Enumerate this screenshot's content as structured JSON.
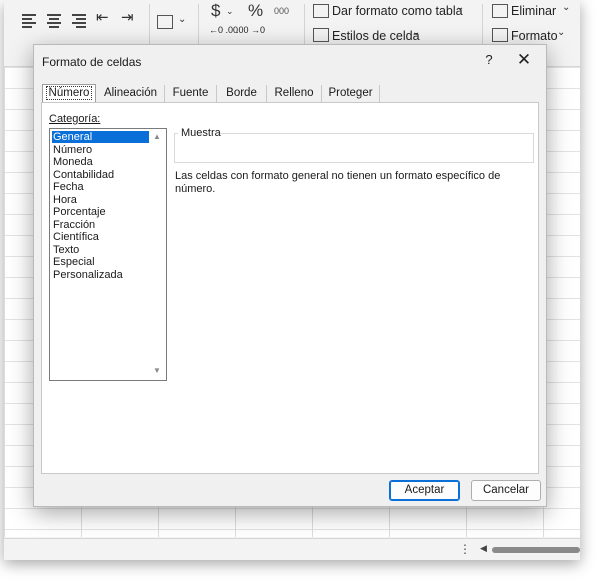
{
  "ribbon": {
    "currency_symbol": "$",
    "percent_symbol": "%",
    "thousands_label": "000",
    "decimal_increase_label": "←0 .00",
    "decimal_decrease_label": ".00 →0",
    "format_as_table_label": "Dar formato como tabla",
    "cell_styles_label": "Estilos de celda",
    "delete_label": "Eliminar",
    "format_label": "Formato"
  },
  "dialog": {
    "title": "Formato de celdas",
    "help_label": "?",
    "close_label": "✕",
    "tabs": [
      {
        "label": "Número"
      },
      {
        "label": "Alineación"
      },
      {
        "label": "Fuente"
      },
      {
        "label": "Borde"
      },
      {
        "label": "Relleno"
      },
      {
        "label": "Proteger"
      }
    ],
    "category_label": "Categoría:",
    "categories": [
      "General",
      "Número",
      "Moneda",
      "Contabilidad",
      "Fecha",
      "Hora",
      "Porcentaje",
      "Fracción",
      "Científica",
      "Texto",
      "Especial",
      "Personalizada"
    ],
    "selected_category": "General",
    "sample_label": "Muestra",
    "description": "Las celdas con formato general no tienen un formato específico de número.",
    "ok_label": "Aceptar",
    "cancel_label": "Cancelar"
  },
  "colors": {
    "accent": "#0b6fd8",
    "dialog_bg": "#f0f0f0",
    "panel_bg": "#ffffff"
  }
}
